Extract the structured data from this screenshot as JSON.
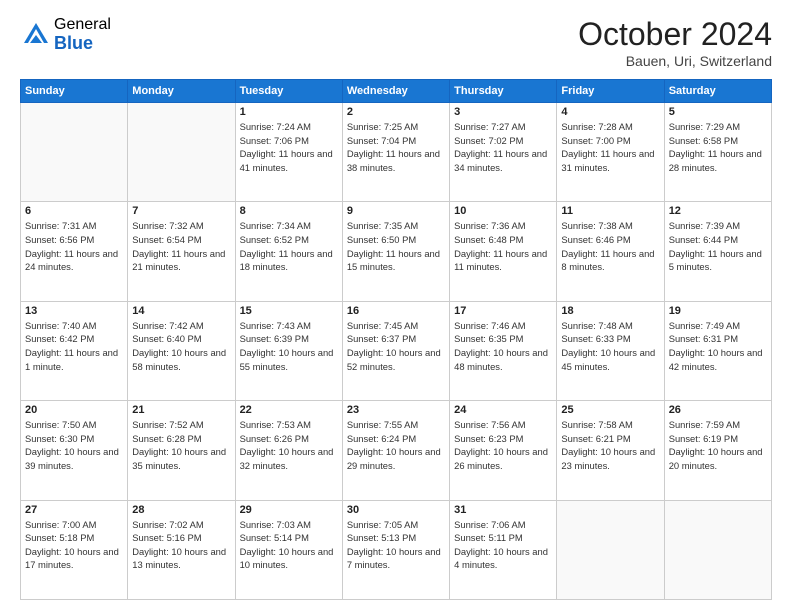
{
  "logo": {
    "general": "General",
    "blue": "Blue"
  },
  "header": {
    "month": "October 2024",
    "location": "Bauen, Uri, Switzerland"
  },
  "weekdays": [
    "Sunday",
    "Monday",
    "Tuesday",
    "Wednesday",
    "Thursday",
    "Friday",
    "Saturday"
  ],
  "weeks": [
    [
      {
        "day": "",
        "empty": true
      },
      {
        "day": "",
        "empty": true
      },
      {
        "day": "1",
        "sunrise": "Sunrise: 7:24 AM",
        "sunset": "Sunset: 7:06 PM",
        "daylight": "Daylight: 11 hours and 41 minutes."
      },
      {
        "day": "2",
        "sunrise": "Sunrise: 7:25 AM",
        "sunset": "Sunset: 7:04 PM",
        "daylight": "Daylight: 11 hours and 38 minutes."
      },
      {
        "day": "3",
        "sunrise": "Sunrise: 7:27 AM",
        "sunset": "Sunset: 7:02 PM",
        "daylight": "Daylight: 11 hours and 34 minutes."
      },
      {
        "day": "4",
        "sunrise": "Sunrise: 7:28 AM",
        "sunset": "Sunset: 7:00 PM",
        "daylight": "Daylight: 11 hours and 31 minutes."
      },
      {
        "day": "5",
        "sunrise": "Sunrise: 7:29 AM",
        "sunset": "Sunset: 6:58 PM",
        "daylight": "Daylight: 11 hours and 28 minutes."
      }
    ],
    [
      {
        "day": "6",
        "sunrise": "Sunrise: 7:31 AM",
        "sunset": "Sunset: 6:56 PM",
        "daylight": "Daylight: 11 hours and 24 minutes."
      },
      {
        "day": "7",
        "sunrise": "Sunrise: 7:32 AM",
        "sunset": "Sunset: 6:54 PM",
        "daylight": "Daylight: 11 hours and 21 minutes."
      },
      {
        "day": "8",
        "sunrise": "Sunrise: 7:34 AM",
        "sunset": "Sunset: 6:52 PM",
        "daylight": "Daylight: 11 hours and 18 minutes."
      },
      {
        "day": "9",
        "sunrise": "Sunrise: 7:35 AM",
        "sunset": "Sunset: 6:50 PM",
        "daylight": "Daylight: 11 hours and 15 minutes."
      },
      {
        "day": "10",
        "sunrise": "Sunrise: 7:36 AM",
        "sunset": "Sunset: 6:48 PM",
        "daylight": "Daylight: 11 hours and 11 minutes."
      },
      {
        "day": "11",
        "sunrise": "Sunrise: 7:38 AM",
        "sunset": "Sunset: 6:46 PM",
        "daylight": "Daylight: 11 hours and 8 minutes."
      },
      {
        "day": "12",
        "sunrise": "Sunrise: 7:39 AM",
        "sunset": "Sunset: 6:44 PM",
        "daylight": "Daylight: 11 hours and 5 minutes."
      }
    ],
    [
      {
        "day": "13",
        "sunrise": "Sunrise: 7:40 AM",
        "sunset": "Sunset: 6:42 PM",
        "daylight": "Daylight: 11 hours and 1 minute."
      },
      {
        "day": "14",
        "sunrise": "Sunrise: 7:42 AM",
        "sunset": "Sunset: 6:40 PM",
        "daylight": "Daylight: 10 hours and 58 minutes."
      },
      {
        "day": "15",
        "sunrise": "Sunrise: 7:43 AM",
        "sunset": "Sunset: 6:39 PM",
        "daylight": "Daylight: 10 hours and 55 minutes."
      },
      {
        "day": "16",
        "sunrise": "Sunrise: 7:45 AM",
        "sunset": "Sunset: 6:37 PM",
        "daylight": "Daylight: 10 hours and 52 minutes."
      },
      {
        "day": "17",
        "sunrise": "Sunrise: 7:46 AM",
        "sunset": "Sunset: 6:35 PM",
        "daylight": "Daylight: 10 hours and 48 minutes."
      },
      {
        "day": "18",
        "sunrise": "Sunrise: 7:48 AM",
        "sunset": "Sunset: 6:33 PM",
        "daylight": "Daylight: 10 hours and 45 minutes."
      },
      {
        "day": "19",
        "sunrise": "Sunrise: 7:49 AM",
        "sunset": "Sunset: 6:31 PM",
        "daylight": "Daylight: 10 hours and 42 minutes."
      }
    ],
    [
      {
        "day": "20",
        "sunrise": "Sunrise: 7:50 AM",
        "sunset": "Sunset: 6:30 PM",
        "daylight": "Daylight: 10 hours and 39 minutes."
      },
      {
        "day": "21",
        "sunrise": "Sunrise: 7:52 AM",
        "sunset": "Sunset: 6:28 PM",
        "daylight": "Daylight: 10 hours and 35 minutes."
      },
      {
        "day": "22",
        "sunrise": "Sunrise: 7:53 AM",
        "sunset": "Sunset: 6:26 PM",
        "daylight": "Daylight: 10 hours and 32 minutes."
      },
      {
        "day": "23",
        "sunrise": "Sunrise: 7:55 AM",
        "sunset": "Sunset: 6:24 PM",
        "daylight": "Daylight: 10 hours and 29 minutes."
      },
      {
        "day": "24",
        "sunrise": "Sunrise: 7:56 AM",
        "sunset": "Sunset: 6:23 PM",
        "daylight": "Daylight: 10 hours and 26 minutes."
      },
      {
        "day": "25",
        "sunrise": "Sunrise: 7:58 AM",
        "sunset": "Sunset: 6:21 PM",
        "daylight": "Daylight: 10 hours and 23 minutes."
      },
      {
        "day": "26",
        "sunrise": "Sunrise: 7:59 AM",
        "sunset": "Sunset: 6:19 PM",
        "daylight": "Daylight: 10 hours and 20 minutes."
      }
    ],
    [
      {
        "day": "27",
        "sunrise": "Sunrise: 7:00 AM",
        "sunset": "Sunset: 5:18 PM",
        "daylight": "Daylight: 10 hours and 17 minutes."
      },
      {
        "day": "28",
        "sunrise": "Sunrise: 7:02 AM",
        "sunset": "Sunset: 5:16 PM",
        "daylight": "Daylight: 10 hours and 13 minutes."
      },
      {
        "day": "29",
        "sunrise": "Sunrise: 7:03 AM",
        "sunset": "Sunset: 5:14 PM",
        "daylight": "Daylight: 10 hours and 10 minutes."
      },
      {
        "day": "30",
        "sunrise": "Sunrise: 7:05 AM",
        "sunset": "Sunset: 5:13 PM",
        "daylight": "Daylight: 10 hours and 7 minutes."
      },
      {
        "day": "31",
        "sunrise": "Sunrise: 7:06 AM",
        "sunset": "Sunset: 5:11 PM",
        "daylight": "Daylight: 10 hours and 4 minutes."
      },
      {
        "day": "",
        "empty": true
      },
      {
        "day": "",
        "empty": true
      }
    ]
  ]
}
